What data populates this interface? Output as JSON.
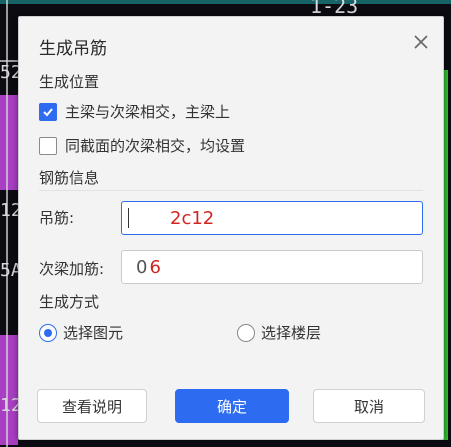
{
  "dialog": {
    "title": "生成吊筋",
    "sections": {
      "position": "生成位置",
      "rebar_info": "钢筋信息",
      "method": "生成方式"
    },
    "options": [
      {
        "label": "主梁与次梁相交，主梁上",
        "checked": true
      },
      {
        "label": "同截面的次梁相交，均设置",
        "checked": false
      }
    ],
    "fields": {
      "hanger_label": "吊筋:",
      "hanger_value": "2c12",
      "extra_label": "次梁加筋:",
      "extra_value": "6"
    },
    "methods": [
      {
        "label": "选择图元",
        "selected": true
      },
      {
        "label": "选择楼层",
        "selected": false
      }
    ],
    "buttons": {
      "help": "查看说明",
      "ok": "确定",
      "cancel": "取消"
    },
    "icons": {
      "close": "close-icon",
      "check": "check-icon"
    },
    "colors": {
      "accent": "#2d6cf0",
      "value_text": "#d1261f"
    }
  },
  "background": {
    "texts": [
      "1-23",
      "52",
      "12",
      "5A",
      "12"
    ]
  }
}
